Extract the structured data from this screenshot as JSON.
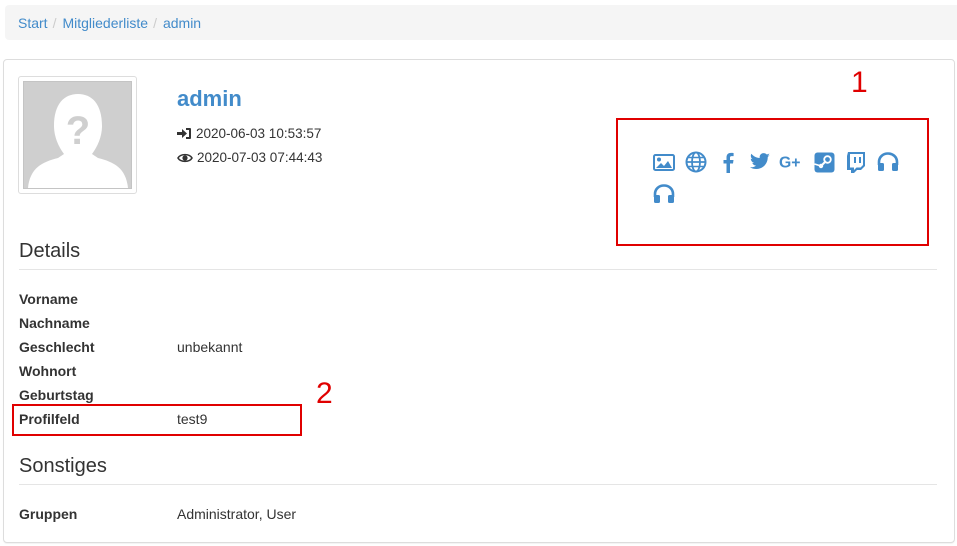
{
  "breadcrumb": {
    "items": [
      "Start",
      "Mitgliederliste"
    ],
    "current": "admin"
  },
  "profile": {
    "username": "admin",
    "last_login": "2020-06-03 10:53:57",
    "last_seen": "2020-07-03 07:44:43",
    "avatar_icon": "question-mark-silhouette-icon"
  },
  "social_icons": [
    "image-icon",
    "globe-icon",
    "facebook-icon",
    "twitter-icon",
    "google-plus-icon",
    "steam-icon",
    "twitch-icon",
    "headphones-icon",
    "headphones-icon"
  ],
  "colors": {
    "link": "#428bca",
    "annotation": "#e00000"
  },
  "annotations": {
    "one": "1",
    "two": "2"
  },
  "details": {
    "title": "Details",
    "rows": [
      {
        "label": "Vorname",
        "value": ""
      },
      {
        "label": "Nachname",
        "value": ""
      },
      {
        "label": "Geschlecht",
        "value": "unbekannt"
      },
      {
        "label": "Wohnort",
        "value": ""
      },
      {
        "label": "Geburtstag",
        "value": ""
      },
      {
        "label": "Profilfeld",
        "value": "test9"
      }
    ]
  },
  "other": {
    "title": "Sonstiges",
    "rows": [
      {
        "label": "Gruppen",
        "value": "Administrator, User"
      }
    ]
  }
}
